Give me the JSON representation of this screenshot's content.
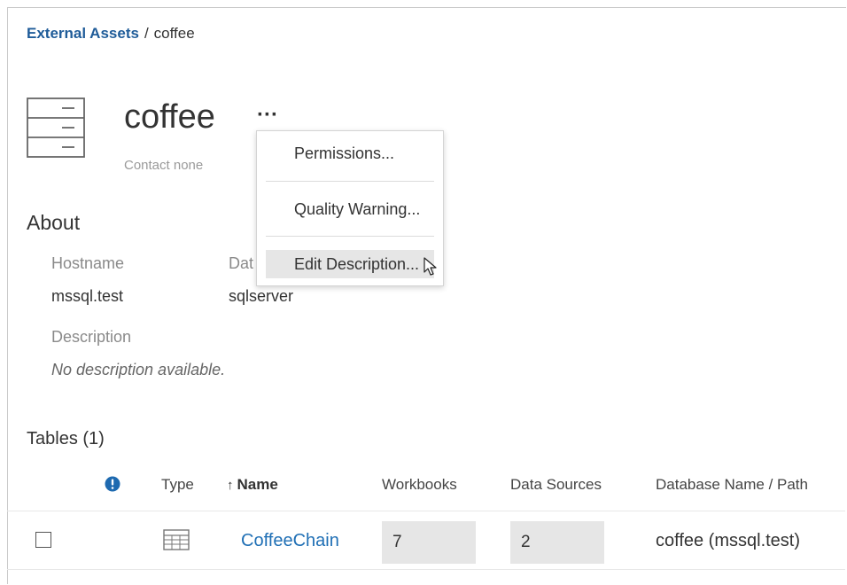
{
  "breadcrumb": {
    "parent": "External Assets",
    "separator": "/",
    "current": "coffee"
  },
  "header": {
    "title": "coffee",
    "more": "···",
    "contact": "Contact  none"
  },
  "menu": {
    "items": [
      {
        "label": "Permissions..."
      },
      {
        "label": "Quality Warning..."
      },
      {
        "label": "Edit Description..."
      }
    ],
    "hovered_item": "Edit Description..."
  },
  "about": {
    "heading": "About",
    "hostname_label": "Hostname",
    "hostname_value": "mssql.test",
    "type_label": "Dat",
    "type_value": "sqlserver",
    "description_label": "Description",
    "description_value": "No description available."
  },
  "tables": {
    "heading": "Tables (1)",
    "columns": {
      "type": "Type",
      "name_sort": "↑",
      "name": "Name",
      "workbooks": "Workbooks",
      "data_sources": "Data Sources",
      "db_path": "Database Name / Path"
    },
    "rows": [
      {
        "name": "CoffeeChain",
        "workbooks": "7",
        "data_sources": "2",
        "db_path": "coffee (mssql.test)"
      }
    ]
  },
  "icons": {
    "database": "database-icon",
    "info": "info-icon",
    "table": "table-icon",
    "cursor": "mouse-pointer-icon"
  },
  "colors": {
    "link": "#1f5c99",
    "name_link": "#1f6fb5",
    "info": "#1e6ab0",
    "muted": "#8a8a8a"
  }
}
